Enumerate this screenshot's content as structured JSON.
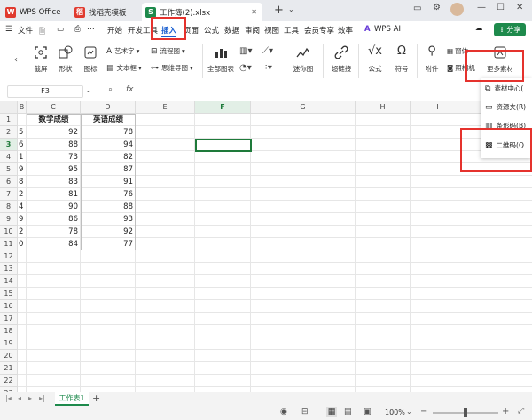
{
  "tabs": [
    {
      "label": "WPS Office"
    },
    {
      "label": "找稻壳模板"
    },
    {
      "label": "工作簿(2).xlsx"
    }
  ],
  "menu": {
    "file": "文件",
    "items": [
      "开始",
      "开发工具",
      "插入",
      "页面",
      "公式",
      "数据",
      "审阅",
      "视图",
      "工具",
      "会员专享",
      "效率"
    ],
    "wps_ai": "WPS AI",
    "share": "分享"
  },
  "toolbar": {
    "screenshot": "截屏",
    "shape": "形状",
    "icon": "图标",
    "wordart": "艺术字",
    "textbox": "文本框",
    "flowchart": "流程图",
    "mindmap": "思维导图",
    "all_charts": "全部图表",
    "sparkline": "迷你图",
    "hyperlink": "超链接",
    "formula": "公式",
    "symbol": "符号",
    "attachment": "附件",
    "form": "窗体",
    "camera": "照相机",
    "more_material": "更多素材"
  },
  "formula_bar": {
    "cell_ref": "F3",
    "fx": "fx"
  },
  "columns": [
    "B",
    "C",
    "D",
    "E",
    "F",
    "G",
    "H",
    "I",
    "J"
  ],
  "rows": [
    "1",
    "2",
    "3",
    "4",
    "5",
    "6",
    "7",
    "8",
    "9",
    "10",
    "11",
    "12",
    "13",
    "14",
    "15",
    "16",
    "17",
    "18",
    "19",
    "20",
    "21",
    "22",
    "23"
  ],
  "table": {
    "headers": [
      "数学成绩",
      "英语成绩"
    ],
    "rows": [
      {
        "b": "5",
        "c": "92",
        "d": "78"
      },
      {
        "b": "6",
        "c": "88",
        "d": "94"
      },
      {
        "b": "1",
        "c": "73",
        "d": "82"
      },
      {
        "b": "9",
        "c": "95",
        "d": "87"
      },
      {
        "b": "8",
        "c": "83",
        "d": "91"
      },
      {
        "b": "2",
        "c": "81",
        "d": "76"
      },
      {
        "b": "4",
        "c": "90",
        "d": "88"
      },
      {
        "b": "9",
        "c": "86",
        "d": "93"
      },
      {
        "b": "2",
        "c": "78",
        "d": "92"
      },
      {
        "b": "0",
        "c": "84",
        "d": "77"
      }
    ]
  },
  "panel": {
    "items": [
      "素材中心(",
      "资源夹(R)",
      "条形码(B)",
      "二维码(Q"
    ]
  },
  "sheet": {
    "name": "工作表1",
    "add": "+"
  },
  "status": {
    "zoom": "100%"
  },
  "colors": {
    "accent_green": "#1e8a4c",
    "highlight_red": "#e5322d",
    "selection_green": "#1e7a3a",
    "active_blue": "#1a5fd0"
  }
}
